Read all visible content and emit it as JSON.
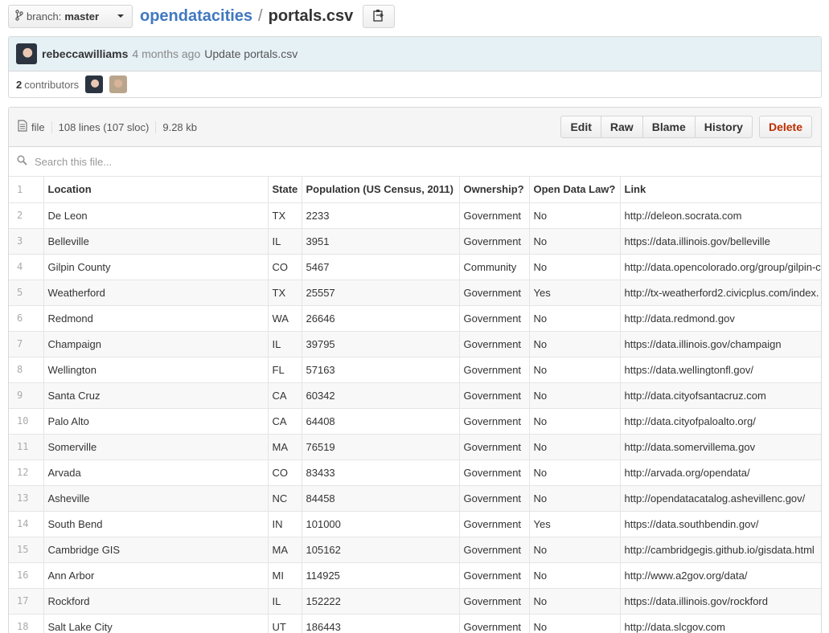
{
  "branch": {
    "prefix": "branch:",
    "name": "master"
  },
  "breadcrumb": {
    "repo": "opendatacities",
    "separator": "/",
    "file": "portals.csv"
  },
  "commit": {
    "author": "rebeccawilliams",
    "time": "4 months ago",
    "message": "Update portals.csv"
  },
  "contributors": {
    "count": "2",
    "label": "contributors"
  },
  "file": {
    "type_label": "file",
    "lines": "108 lines (107 sloc)",
    "size": "9.28 kb",
    "actions": {
      "edit": "Edit",
      "raw": "Raw",
      "blame": "Blame",
      "history": "History",
      "delete": "Delete"
    }
  },
  "search": {
    "placeholder": "Search this file..."
  },
  "table": {
    "header_line": "1",
    "columns": [
      "Location",
      "State",
      "Population (US Census, 2011)",
      "Ownership?",
      "Open Data Law?",
      "Link"
    ],
    "rows": [
      [
        "2",
        "De Leon",
        "TX",
        "2233",
        "Government",
        "No",
        "http://deleon.socrata.com"
      ],
      [
        "3",
        "Belleville",
        "IL",
        "3951",
        "Government",
        "No",
        "https://data.illinois.gov/belleville"
      ],
      [
        "4",
        "Gilpin County",
        "CO",
        "5467",
        "Community",
        "No",
        "http://data.opencolorado.org/group/gilpin-c"
      ],
      [
        "5",
        "Weatherford",
        "TX",
        "25557",
        "Government",
        "Yes",
        "http://tx-weatherford2.civicplus.com/index."
      ],
      [
        "6",
        "Redmond",
        "WA",
        "26646",
        "Government",
        "No",
        "http://data.redmond.gov"
      ],
      [
        "7",
        "Champaign",
        "IL",
        "39795",
        "Government",
        "No",
        "https://data.illinois.gov/champaign"
      ],
      [
        "8",
        "Wellington",
        "FL",
        "57163",
        "Government",
        "No",
        "https://data.wellingtonfl.gov/"
      ],
      [
        "9",
        "Santa Cruz",
        "CA",
        "60342",
        "Government",
        "No",
        "http://data.cityofsantacruz.com"
      ],
      [
        "10",
        "Palo Alto",
        "CA",
        "64408",
        "Government",
        "No",
        "http://data.cityofpaloalto.org/"
      ],
      [
        "11",
        "Somerville",
        "MA",
        "76519",
        "Government",
        "No",
        "http://data.somervillema.gov"
      ],
      [
        "12",
        "Arvada",
        "CO",
        "83433",
        "Government",
        "No",
        "http://arvada.org/opendata/"
      ],
      [
        "13",
        "Asheville",
        "NC",
        "84458",
        "Government",
        "No",
        "http://opendatacatalog.ashevillenc.gov/"
      ],
      [
        "14",
        "South Bend",
        "IN",
        "101000",
        "Government",
        "Yes",
        "https://data.southbendin.gov/"
      ],
      [
        "15",
        "Cambridge GIS",
        "MA",
        "105162",
        "Government",
        "No",
        "http://cambridgegis.github.io/gisdata.html"
      ],
      [
        "16",
        "Ann Arbor",
        "MI",
        "114925",
        "Government",
        "No",
        "http://www.a2gov.org/data/"
      ],
      [
        "17",
        "Rockford",
        "IL",
        "152222",
        "Government",
        "No",
        "https://data.illinois.gov/rockford"
      ],
      [
        "18",
        "Salt Lake City",
        "UT",
        "186443",
        "Government",
        "No",
        "http://data.slcgov.com"
      ]
    ]
  }
}
